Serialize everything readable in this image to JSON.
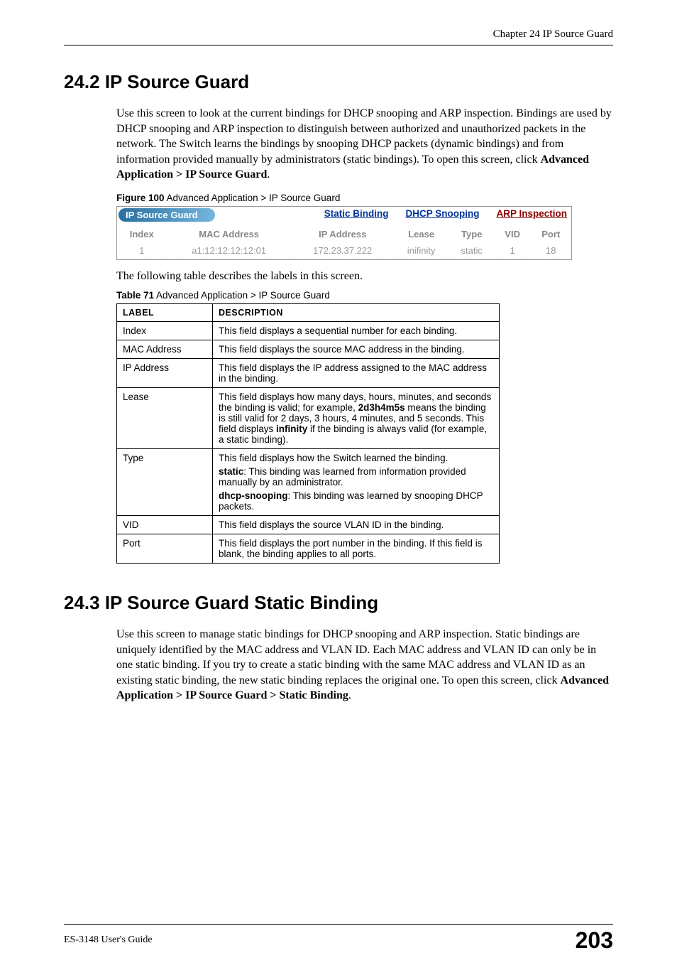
{
  "header": {
    "chapter": "Chapter 24 IP Source Guard"
  },
  "section1": {
    "heading": "24.2  IP Source Guard",
    "para_before": "Use this screen to look at the current bindings for DHCP snooping and ARP inspection. Bindings are used by DHCP snooping and ARP inspection to distinguish between authorized and unauthorized packets in the network. The Switch learns the bindings by snooping DHCP packets (dynamic bindings) and from information provided manually by administrators (static bindings). To open this screen, click ",
    "para_click_bold": "Advanced Application > IP Source Guard",
    "para_after": "."
  },
  "figure100": {
    "label_bold": "Figure 100",
    "label_rest": "   Advanced Application > IP Source Guard",
    "tab_title": "IP Source Guard",
    "links": [
      "Static Binding",
      "DHCP Snooping",
      "ARP Inspection"
    ],
    "columns": [
      "Index",
      "MAC Address",
      "IP Address",
      "Lease",
      "Type",
      "VID",
      "Port"
    ],
    "row": [
      "1",
      "a1:12:12:12:12:01",
      "172.23.37.222",
      "inifinity",
      "static",
      "1",
      "18"
    ]
  },
  "follow_text": "The following table describes the labels in this screen.",
  "table71": {
    "label_bold": "Table 71",
    "label_rest": "   Advanced Application > IP Source Guard",
    "headers": [
      "LABEL",
      "DESCRIPTION"
    ],
    "rows": [
      {
        "label": "Index",
        "desc": "This field displays a sequential number for each binding."
      },
      {
        "label": "MAC Address",
        "desc": "This field displays the source MAC address in the binding."
      },
      {
        "label": "IP Address",
        "desc": "This field displays the IP address assigned to the MAC address in the binding."
      },
      {
        "label": "Lease",
        "desc_pre": "This field displays how many days, hours, minutes, and seconds the binding is valid; for example, ",
        "b1": "2d3h4m5s",
        "desc_mid": " means the binding is still valid for 2 days, 3 hours, 4 minutes, and 5 seconds. This field displays ",
        "b2": "infinity",
        "desc_post": " if the binding is always valid (for example, a static binding)."
      },
      {
        "label": "Type",
        "desc_line1": "This field displays how the Switch learned the binding.",
        "static_b": "static",
        "static_rest": ": This binding was learned from information provided manually by an administrator.",
        "dhcp_b": "dhcp-snooping",
        "dhcp_rest": ": This binding was learned by snooping DHCP packets."
      },
      {
        "label": "VID",
        "desc": "This field displays the source VLAN ID in the binding."
      },
      {
        "label": "Port",
        "desc": "This field displays the port number in the binding. If this field is blank, the binding applies to all ports."
      }
    ]
  },
  "section2": {
    "heading": "24.3  IP Source Guard Static Binding",
    "para_before": "Use this screen to manage static bindings for DHCP snooping and ARP inspection. Static bindings are uniquely identified by the MAC address and VLAN ID. Each MAC address and VLAN ID can only be in one static binding. If you try to create a static binding with the same MAC address and VLAN ID as an existing static binding, the new static binding replaces the original one. To open this screen, click ",
    "para_click_bold": "Advanced Application > IP Source Guard > Static Binding",
    "para_after": "."
  },
  "footer": {
    "guide": "ES-3148 User's Guide",
    "page": "203"
  }
}
